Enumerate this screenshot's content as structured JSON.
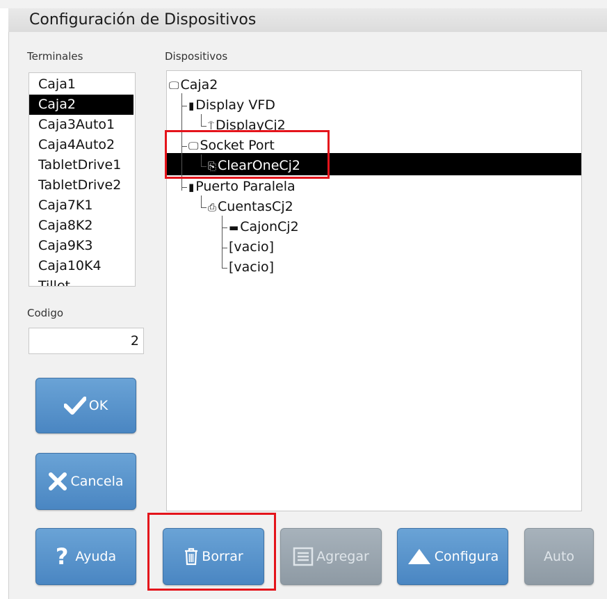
{
  "window": {
    "title": "Configuración de Dispositivos"
  },
  "terminals": {
    "label": "Terminales",
    "items": [
      "Caja1",
      "Caja2",
      "Caja3Auto1",
      "Caja4Auto2",
      "TabletDrive1",
      "TabletDrive2",
      "Caja7K1",
      "Caja8K2",
      "Caja9K3",
      "Caja10K4",
      "Tillet"
    ],
    "selected": "Caja2"
  },
  "codigo": {
    "label": "Codigo",
    "value": "2"
  },
  "devices": {
    "label": "Dispositivos",
    "tree": [
      {
        "label": "Caja2",
        "icon": "monitor-icon",
        "depth": 0
      },
      {
        "label": "Display VFD",
        "icon": "port-icon",
        "depth": 1
      },
      {
        "label": "DisplayCj2",
        "icon": "vfd-display-icon",
        "depth": 2
      },
      {
        "label": "Socket Port",
        "icon": "monitor-icon",
        "depth": 1
      },
      {
        "label": "ClearOneCj2",
        "icon": "clipboard-icon",
        "depth": 2,
        "selected": true
      },
      {
        "label": "Puerto Paralela",
        "icon": "port-icon",
        "depth": 1
      },
      {
        "label": "CuentasCj2",
        "icon": "printer-icon",
        "depth": 2
      },
      {
        "label": "CajonCj2",
        "icon": "cash-drawer-icon",
        "depth": 3
      },
      {
        "label": "[vacio]",
        "icon": "",
        "depth": 3
      },
      {
        "label": "[vacio]",
        "icon": "",
        "depth": 3
      }
    ]
  },
  "buttons": {
    "ok": "OK",
    "cancel": "Cancela",
    "help": "Ayuda",
    "delete": "Borrar",
    "add": "Agregar",
    "configure": "Configura",
    "auto": "Auto"
  },
  "colors": {
    "button": "#5a95cc",
    "button_disabled": "#97a3ad",
    "highlight": "#e4141b",
    "selection": "#000000"
  }
}
